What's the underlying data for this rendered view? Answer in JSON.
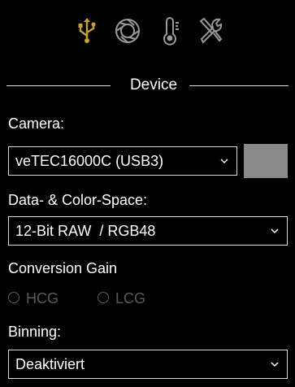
{
  "header": {
    "tabs": [
      {
        "icon": "usb-icon",
        "color": "#c8a03a"
      },
      {
        "icon": "aperture-icon",
        "color": "#9a9a9a"
      },
      {
        "icon": "thermometer-icon",
        "color": "#9a9a9a"
      },
      {
        "icon": "tools-icon",
        "color": "#9a9a9a"
      }
    ]
  },
  "section": {
    "title": "Device"
  },
  "camera": {
    "label": "Camera:",
    "value": "veTEC16000C (USB3)",
    "swatch_color": "#8a8a8a"
  },
  "colorspace": {
    "label": "Data- & Color-Space:",
    "value": "12-Bit RAW  / RGB48"
  },
  "conversion_gain": {
    "label": "Conversion Gain",
    "options": [
      {
        "label": "HCG",
        "selected": false,
        "enabled": false
      },
      {
        "label": "LCG",
        "selected": false,
        "enabled": false
      }
    ]
  },
  "binning": {
    "label": "Binning:",
    "value": "Deaktiviert"
  }
}
